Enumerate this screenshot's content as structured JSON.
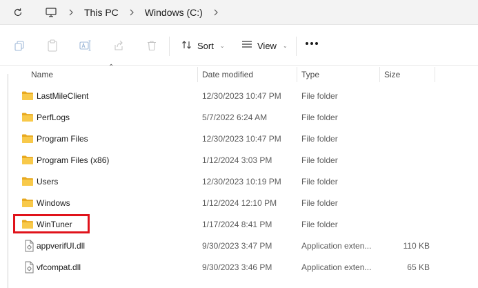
{
  "address": {
    "refresh_icon": "refresh-icon",
    "pc_icon": "monitor-icon",
    "crumbs": [
      "This PC",
      "Windows (C:)"
    ]
  },
  "toolbar": {
    "icons": [
      "copy-icon",
      "paste-icon",
      "rename-icon",
      "share-icon",
      "delete-icon"
    ],
    "sort_label": "Sort",
    "view_label": "View",
    "more_icon": "more-icon"
  },
  "columns": {
    "name": "Name",
    "date": "Date modified",
    "type": "Type",
    "size": "Size"
  },
  "files": [
    {
      "name": "LastMileClient",
      "date": "12/30/2023 10:47 PM",
      "type": "File folder",
      "size": "",
      "kind": "folder"
    },
    {
      "name": "PerfLogs",
      "date": "5/7/2022 6:24 AM",
      "type": "File folder",
      "size": "",
      "kind": "folder"
    },
    {
      "name": "Program Files",
      "date": "12/30/2023 10:47 PM",
      "type": "File folder",
      "size": "",
      "kind": "folder"
    },
    {
      "name": "Program Files (x86)",
      "date": "1/12/2024 3:03 PM",
      "type": "File folder",
      "size": "",
      "kind": "folder"
    },
    {
      "name": "Users",
      "date": "12/30/2023 10:19 PM",
      "type": "File folder",
      "size": "",
      "kind": "folder"
    },
    {
      "name": "Windows",
      "date": "1/12/2024 12:10 PM",
      "type": "File folder",
      "size": "",
      "kind": "folder"
    },
    {
      "name": "WinTuner",
      "date": "1/17/2024 8:41 PM",
      "type": "File folder",
      "size": "",
      "kind": "folder"
    },
    {
      "name": "appverifUI.dll",
      "date": "9/30/2023 3:47 PM",
      "type": "Application exten...",
      "size": "110 KB",
      "kind": "dll"
    },
    {
      "name": "vfcompat.dll",
      "date": "9/30/2023 3:46 PM",
      "type": "Application exten...",
      "size": "65 KB",
      "kind": "dll"
    }
  ],
  "highlight_color": "#e0131b",
  "folder_color": "#f5c242"
}
